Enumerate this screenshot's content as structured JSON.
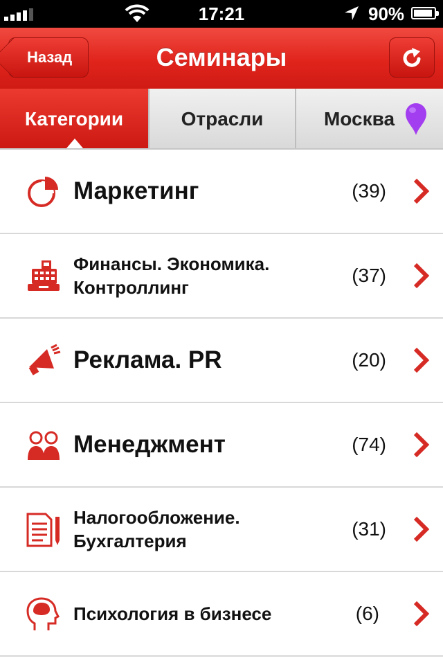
{
  "status_bar": {
    "time": "17:21",
    "battery": "90%"
  },
  "nav": {
    "back_label": "Назад",
    "title": "Семинары"
  },
  "tabs": [
    {
      "label": "Категории",
      "active": true
    },
    {
      "label": "Отрасли",
      "active": false
    },
    {
      "label": "Москва",
      "active": false
    }
  ],
  "categories": [
    {
      "title": "Маркетинг",
      "count": "(39)",
      "icon": "pie-chart-icon"
    },
    {
      "title": "Финансы. Экономика. Контроллинг",
      "count": "(37)",
      "icon": "cash-register-icon"
    },
    {
      "title": "Реклама. PR",
      "count": "(20)",
      "icon": "megaphone-icon"
    },
    {
      "title": "Менеджмент",
      "count": "(74)",
      "icon": "people-icon"
    },
    {
      "title": "Налогообложение. Бухгалтерия",
      "count": "(31)",
      "icon": "document-pencil-icon"
    },
    {
      "title": "Психология в бизнесе",
      "count": "(6)",
      "icon": "head-brain-icon"
    }
  ],
  "colors": {
    "accent": "#e02a22",
    "pin": "#a33df0"
  }
}
